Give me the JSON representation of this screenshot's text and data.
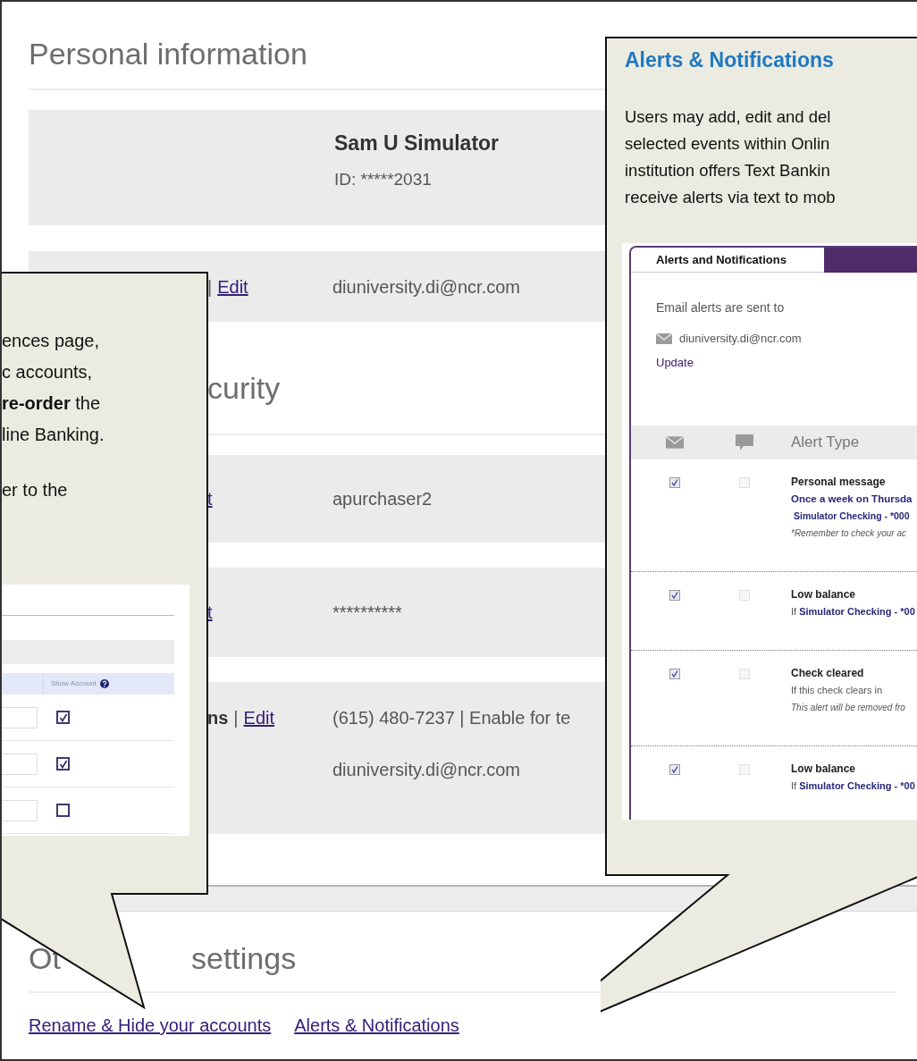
{
  "personal_information": {
    "heading": "Personal information",
    "profile": {
      "name": "Sam U Simulator",
      "id_text": "ID: *****2031"
    },
    "rows": [
      {
        "label": [
          {
            "kind": "separator",
            "text": "|"
          },
          {
            "kind": "link",
            "text": "Edit"
          }
        ],
        "values": [
          "diuniversity.di@ncr.com"
        ]
      }
    ]
  },
  "security": {
    "heading": "curity",
    "rows": [
      {
        "label": [
          {
            "kind": "link",
            "text": "t"
          }
        ],
        "values": [
          "apurchaser2"
        ]
      },
      {
        "label": [
          {
            "kind": "link",
            "text": "t"
          }
        ],
        "values": [
          "**********"
        ]
      },
      {
        "label": [
          {
            "kind": "bold",
            "text": "ns"
          },
          {
            "kind": "separator",
            "text": "|"
          },
          {
            "kind": "link",
            "text": "Edit"
          }
        ],
        "values": [
          "(615) 480-7237 |  Enable for te",
          "diuniversity.di@ncr.com"
        ]
      }
    ]
  },
  "other_settings": {
    "heading_parts": [
      "Ot",
      "settings"
    ],
    "links": [
      "Rename & Hide your accounts",
      "Alerts & Notifications"
    ]
  },
  "left_callout": {
    "paragraphs": [
      [
        "ences page,",
        "c accounts,",
        "**re-order** the",
        "line Banking."
      ],
      [
        "er to the"
      ]
    ],
    "screenshot": {
      "column_header": "Show Account",
      "rows": [
        {
          "checked": true
        },
        {
          "checked": true
        },
        {
          "checked": false
        }
      ]
    }
  },
  "right_callout": {
    "title": "Alerts & Notifications",
    "paragraph_lines": [
      "Users may add, edit and del",
      "selected events within Onlin",
      "institution offers Text Bankin",
      "receive alerts via text to mob"
    ],
    "screenshot": {
      "tabs": [
        {
          "label": "Alerts and Notifications",
          "selected": true
        }
      ],
      "email_intro": "Email alerts are sent to",
      "email": "diuniversity.di@ncr.com",
      "update_link": "Update",
      "column_header": "Alert Type",
      "alerts": [
        {
          "title": "Personal message",
          "email_checked": true,
          "text_checked": false,
          "lines": [
            {
              "kind": "emphasis",
              "text": "Once a week on Thursda"
            },
            {
              "kind": "account",
              "text": "Simulator Checking - *000"
            },
            {
              "kind": "note",
              "text": "*Remember to check your ac"
            }
          ]
        },
        {
          "title": "Low balance",
          "email_checked": true,
          "text_checked": false,
          "lines": [
            {
              "kind": "plain",
              "text": "If **Simulator Checking - *00**"
            }
          ]
        },
        {
          "title": "Check cleared",
          "email_checked": true,
          "text_checked": false,
          "lines": [
            {
              "kind": "plain",
              "text": "If this check clears in"
            },
            {
              "kind": "note",
              "text": "This alert will be removed fro"
            }
          ]
        },
        {
          "title": "Low balance",
          "email_checked": true,
          "text_checked": false,
          "lines": [
            {
              "kind": "plain",
              "text": "If **Simulator Checking - *00**"
            }
          ]
        }
      ]
    }
  }
}
